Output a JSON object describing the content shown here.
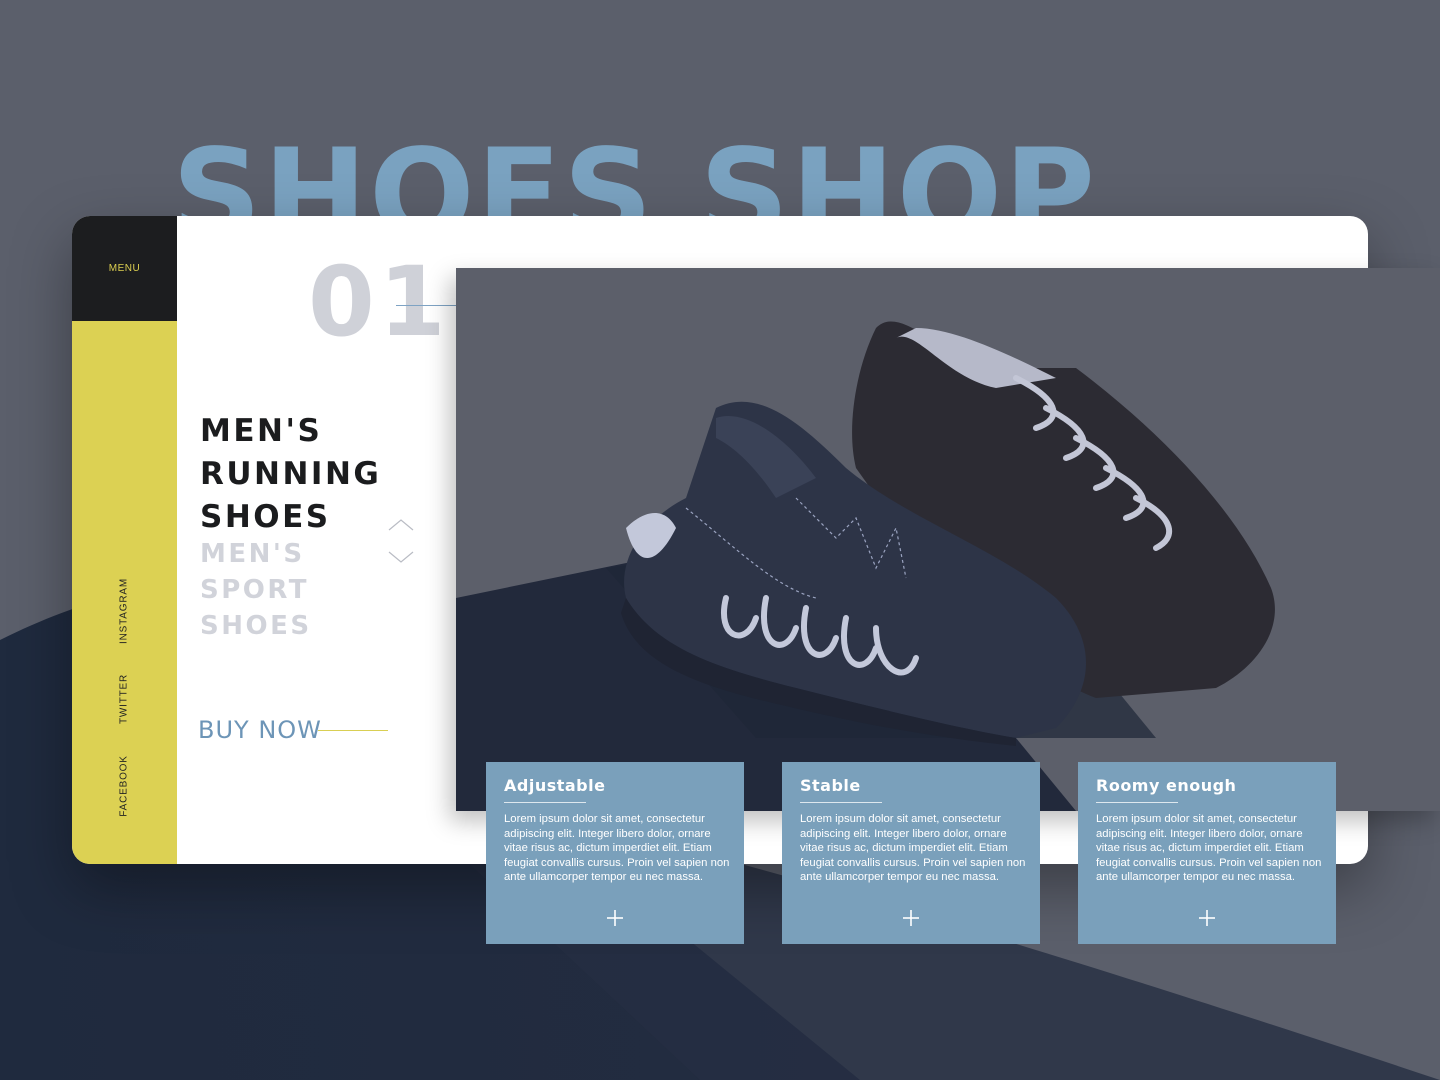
{
  "hero": {
    "title": "SHOES SHOP"
  },
  "nav": {
    "menu_label": "MENU",
    "social": [
      "INSTAGRAM",
      "TWITTER",
      "FACEBOOK"
    ]
  },
  "slide": {
    "number": "01",
    "active_product": "MEN'S\nRUNNING\nSHOES",
    "next_product": "MEN'S\nSPORT\nSHOES",
    "cta": "BUY NOW"
  },
  "features": [
    {
      "title": "Adjustable",
      "text": "Lorem ipsum dolor sit amet, consectetur adipiscing elit. Integer libero dolor, ornare vitae risus ac, dictum imperdiet elit. Etiam feugiat convallis cursus. Proin vel sapien non ante ullamcorper tempor eu nec massa."
    },
    {
      "title": "Stable",
      "text": "Lorem ipsum dolor sit amet, consectetur adipiscing elit. Integer libero dolor, ornare vitae risus ac, dictum imperdiet elit. Etiam feugiat convallis cursus. Proin vel sapien non ante ullamcorper tempor eu nec massa."
    },
    {
      "title": "Roomy enough",
      "text": "Lorem ipsum dolor sit amet, consectetur adipiscing elit. Integer libero dolor, ornare vitae risus ac, dictum imperdiet elit. Etiam feugiat convallis cursus. Proin vel sapien non ante ullamcorper tempor eu nec massa."
    }
  ],
  "colors": {
    "background": "#5b5f6b",
    "accent_yellow": "#dcd153",
    "accent_blue": "#7aa0bb",
    "title_blue": "#7aa2c0",
    "dark": "#1c1d1f"
  }
}
